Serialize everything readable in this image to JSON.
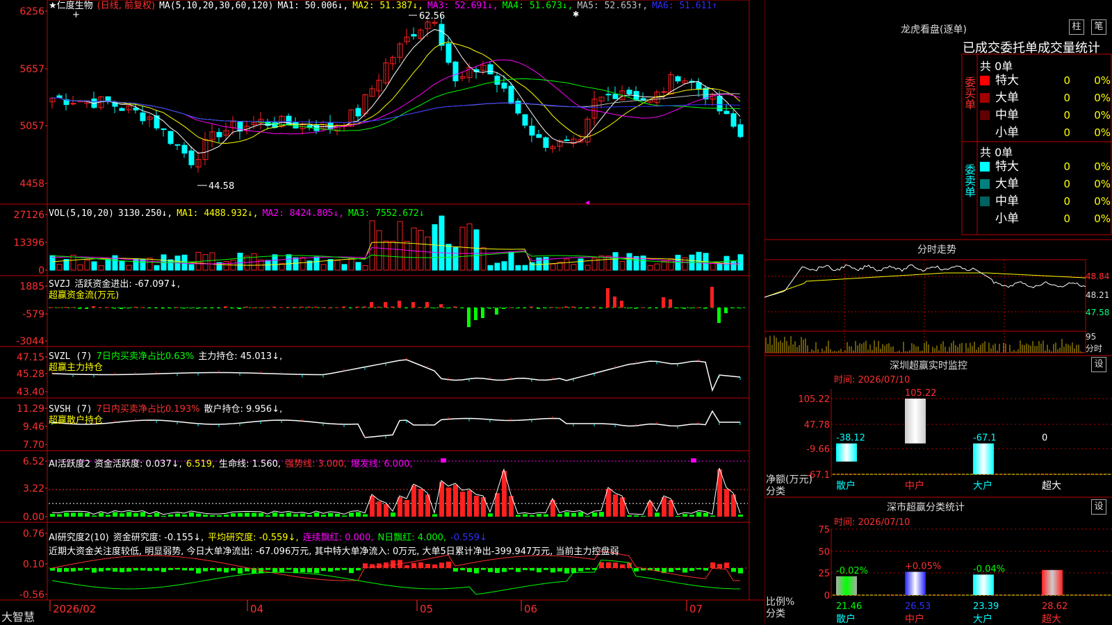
{
  "app_brand": "大智慧",
  "colors": {
    "up": "#ff2020",
    "down": "#00ffff",
    "ma1": "#ffffff",
    "ma2": "#ffff00",
    "ma3": "#ff00ff",
    "ma4": "#00ff00",
    "ma5": "#c0c0c0",
    "ma6": "#3030ff",
    "frame": "#c00000",
    "bg": "#000000"
  },
  "main_chart": {
    "star": "★",
    "stock_name": "仁度生物",
    "mode": "(日线, 前复权)",
    "ma_params": "MA(5,10,20,30,60,120)",
    "ma1": "MA1: 50.006↓,",
    "ma2": "MA2: 51.387↓,",
    "ma3": "MA3: 52.691↓,",
    "ma4": "MA4: 51.673↓,",
    "ma5": "MA5: 52.653↑,",
    "ma6": "MA6: 51.611↑",
    "y_ticks": [
      "6256",
      "5657",
      "5057",
      "4458"
    ],
    "high_label": "62.56",
    "low_label": "44.58",
    "ylim": [
      4458,
      6256
    ]
  },
  "vol_panel": {
    "title": "VOL(5,10,20)",
    "value": "3130.250↓,",
    "ma1": "MA1: 4488.932↓,",
    "ma2": "MA2: 8424.805↓,",
    "ma3": "MA3: 7552.672↓",
    "y_ticks": [
      "27126",
      "13396",
      "0"
    ]
  },
  "svzj_panel": {
    "title": "SVZJ",
    "label": "活跃资金进出: -67.097↓,",
    "sub": "超赢资金流(万元)",
    "y_ticks": [
      "1885",
      "-579",
      "-3044"
    ]
  },
  "svzl_panel": {
    "title": "SVZL (7)",
    "label1": "7日内买卖净占比0.63%",
    "label2": "主力持仓: 45.013↓,",
    "sub": "超赢主力持仓",
    "y_ticks": [
      "47.15",
      "45.28",
      "43.40"
    ]
  },
  "svsh_panel": {
    "title": "SVSH (7)",
    "label1": "7日内买卖净占比0.193%",
    "label2": "散户持仓: 9.956↓,",
    "sub": "超赢散户持仓",
    "y_ticks": [
      "11.29",
      "9.46",
      "7.70"
    ]
  },
  "ai_active_panel": {
    "title": "AI活跃度2",
    "l1": "资金活跃度: 0.037↓,",
    "l2": "6.519,",
    "l3": "生命线: 1.560,",
    "l4": "强势线: 3.000,",
    "l5": "爆发线: 6.000,",
    "y_ticks": [
      "6.52",
      "3.22",
      "0.00"
    ]
  },
  "ai_research_panel": {
    "title": "AI研究度2(10)",
    "l1": "资金研究度: -0.155↓,",
    "l2": "平均研究度: -0.559↓,",
    "l3": "连续飘红: 0.000,",
    "l4": "N日飘红: 4.000,",
    "l5": "-0.559↓",
    "comment": "近期大资金关注度较低, 明显弱势, 今日大单净流出: -67.096万元, 其中特大单净流入: 0万元, 大单5日累计净出-399.947万元, 当前主力控盘弱",
    "y_ticks": [
      "0.76",
      "0.10",
      "-0.56"
    ]
  },
  "date_axis": [
    "2026/02",
    "04",
    "05",
    "06",
    "07"
  ],
  "right_panel": {
    "lhb_title": "龙虎看盘(逐单)",
    "btn_zhu": "柱",
    "btn_bi": "笔",
    "tabs_row": "已成交委托单成交量统计",
    "buy_label": "委买单",
    "sell_label": "委卖单",
    "buy_total": "共 0单",
    "sell_total": "共 0单",
    "buy_rows": [
      {
        "name": "特大",
        "count": "0",
        "pct": "0%",
        "color": "#ff0000"
      },
      {
        "name": "大单",
        "count": "0",
        "pct": "0%",
        "color": "#a00000"
      },
      {
        "name": "中单",
        "count": "0",
        "pct": "0%",
        "color": "#600000"
      },
      {
        "name": "小单",
        "count": "0",
        "pct": "0%",
        "color": "#000000"
      }
    ],
    "sell_rows": [
      {
        "name": "特大",
        "count": "0",
        "pct": "0%",
        "color": "#00ffff"
      },
      {
        "name": "大单",
        "count": "0",
        "pct": "0%",
        "color": "#008080"
      },
      {
        "name": "中单",
        "count": "0",
        "pct": "0%",
        "color": "#006060"
      },
      {
        "name": "小单",
        "count": "0",
        "pct": "0%",
        "color": "#000000"
      }
    ],
    "intraday_title": "分时走势",
    "intraday_ticks": [
      "48.84",
      "48.21",
      "47.58"
    ],
    "intraday_vol_tick": "95",
    "intraday_unit": "分时",
    "sz_monitor_title": "深圳超赢实时监控",
    "sz_monitor_btn": "设",
    "sz_monitor_time": "时间: 2026/07/10",
    "sz_monitor_ticks": [
      "105.22",
      "47.78",
      "-9.66",
      "-67.1"
    ],
    "sz_monitor_unit": "净额(万元)",
    "sz_monitor_cat_label": "分类",
    "sz_monitor_cats": [
      "散户",
      "中户",
      "大户",
      "超大"
    ],
    "sz_monitor_values": [
      "-38.12",
      "105.22",
      "-67.1",
      "0"
    ],
    "sz_class_title": "深市超赢分类统计",
    "sz_class_btn": "设",
    "sz_class_time": "时间: 2026/07/10",
    "sz_class_ticks": [
      "75",
      "50",
      "25",
      "0"
    ],
    "sz_class_unit": "比例%",
    "sz_class_cat_label": "分类",
    "sz_class_cats": [
      "散户",
      "中户",
      "大户",
      "超大"
    ],
    "sz_class_changes": [
      "-0.02%",
      "+0.05%",
      "-0.04%",
      ""
    ],
    "sz_class_values": [
      "21.46",
      "26.53",
      "23.39",
      "28.62"
    ]
  },
  "chart_data": {
    "type": "bar",
    "categories": [
      "散户",
      "中户",
      "大户",
      "超大"
    ],
    "values": [
      -38.12,
      105.22,
      -67.1,
      0
    ],
    "ylim": [
      -67.1,
      105.22
    ],
    "ylabel": "净额(万元)"
  }
}
